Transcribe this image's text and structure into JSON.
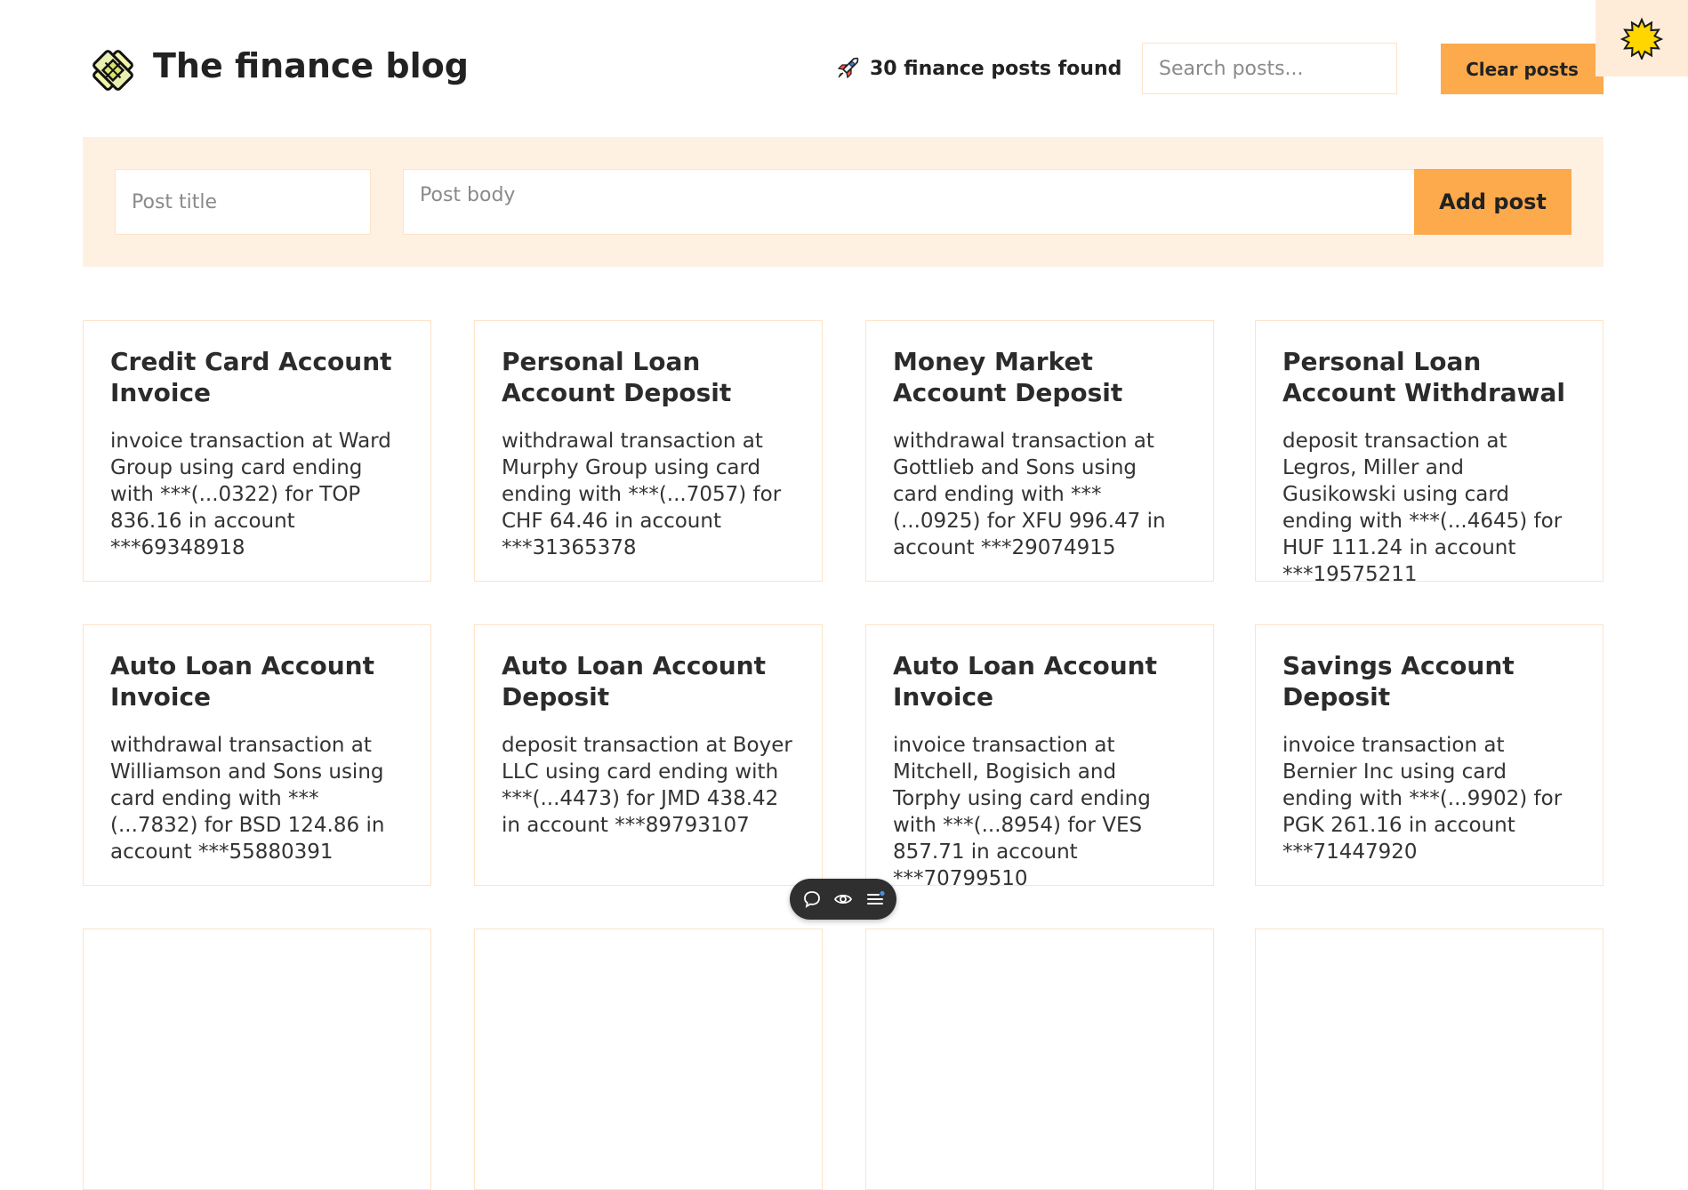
{
  "header": {
    "site_title": "The finance blog",
    "posts_found_text": "30 finance posts found",
    "search_placeholder": "Search posts...",
    "clear_button": "Clear posts"
  },
  "add_form": {
    "title_placeholder": "Post title",
    "body_placeholder": "Post body",
    "add_button": "Add post"
  },
  "colors": {
    "accent": "#fcaa4c",
    "panel": "#fff1e2",
    "border": "#fde3c8"
  },
  "icons": {
    "logo": "app-logo-icon",
    "posts_found": "rocket-icon",
    "theme": "sun-icon",
    "toolbar": [
      "chat-icon",
      "eye-icon",
      "menu-icon"
    ]
  },
  "posts": [
    {
      "title": "Credit Card Account Invoice",
      "body": "invoice transaction at Ward Group using card ending with ***(...0322) for TOP 836.16 in account ***69348918"
    },
    {
      "title": "Personal Loan Account Deposit",
      "body": "withdrawal transaction at Murphy Group using card ending with ***(...7057) for CHF 64.46 in account ***31365378"
    },
    {
      "title": "Money Market Account Deposit",
      "body": "withdrawal transaction at Gottlieb and Sons using card ending with ***(...0925) for XFU 996.47 in account ***29074915"
    },
    {
      "title": "Personal Loan Account Withdrawal",
      "body": "deposit transaction at Legros, Miller and Gusikowski using card ending with ***(...4645) for HUF 111.24 in account ***19575211"
    },
    {
      "title": "Auto Loan Account Invoice",
      "body": "withdrawal transaction at Williamson and Sons using card ending with ***(...7832) for BSD 124.86 in account ***55880391"
    },
    {
      "title": "Auto Loan Account Deposit",
      "body": "deposit transaction at Boyer LLC using card ending with ***(...4473) for JMD 438.42 in account ***89793107"
    },
    {
      "title": "Auto Loan Account Invoice",
      "body": "invoice transaction at Mitchell, Bogisich and Torphy using card ending with ***(...8954) for VES 857.71 in account ***70799510"
    },
    {
      "title": "Savings Account Deposit",
      "body": "invoice transaction at Bernier Inc using card ending with ***(...9902) for PGK 261.16 in account ***71447920"
    }
  ]
}
